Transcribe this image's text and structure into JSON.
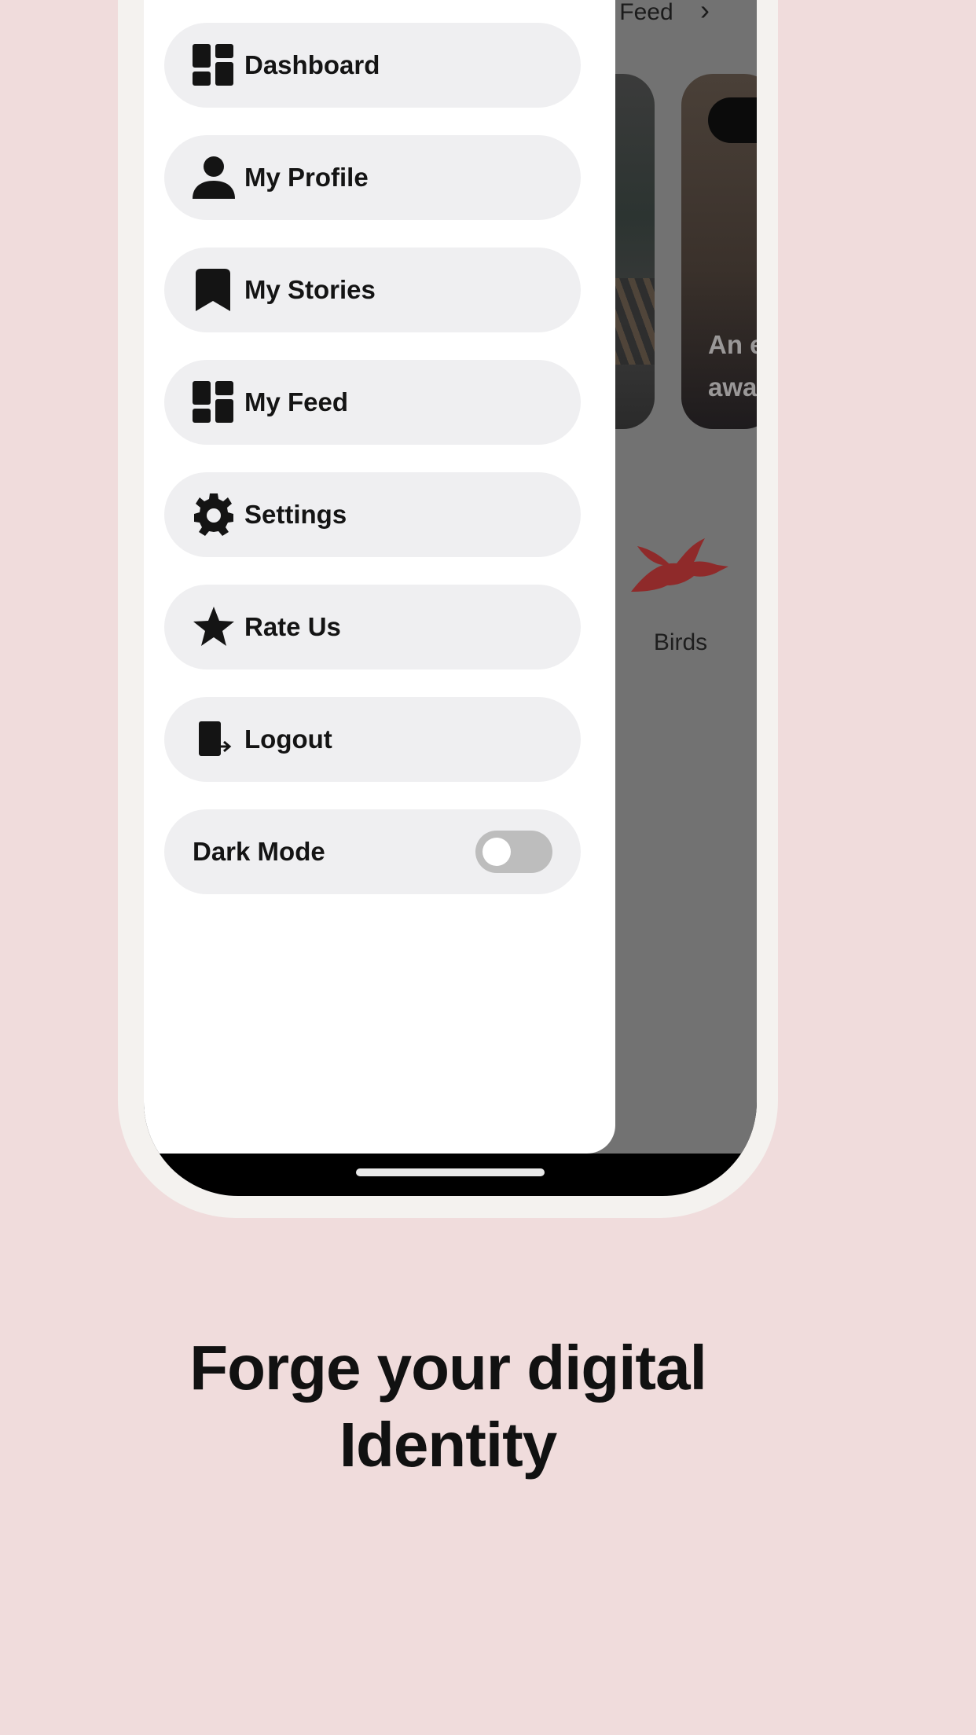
{
  "feed": {
    "see_more_label": "Feed",
    "cards": [
      {
        "caption_line1": "",
        "caption_line2": ""
      },
      {
        "caption_line1": "An e",
        "caption_line2": "awa"
      }
    ],
    "category": {
      "label": "Birds",
      "icon": "bird-icon",
      "icon_color": "#8f2a2a"
    }
  },
  "drawer": {
    "items": [
      {
        "label": "Dashboard",
        "icon": "dashboard-icon"
      },
      {
        "label": "My Profile",
        "icon": "person-icon"
      },
      {
        "label": "My Stories",
        "icon": "bookmark-icon"
      },
      {
        "label": "My Feed",
        "icon": "dashboard-icon"
      },
      {
        "label": "Settings",
        "icon": "gear-icon"
      },
      {
        "label": "Rate Us",
        "icon": "star-icon"
      },
      {
        "label": "Logout",
        "icon": "logout-icon"
      }
    ],
    "dark_mode": {
      "label": "Dark Mode",
      "enabled": false
    }
  },
  "headline": {
    "line1": "Forge your digital",
    "line2": "Identity"
  },
  "colors": {
    "page_background": "#f0dcdc",
    "drawer_item_background": "#efeff1",
    "scrim": "#727272"
  }
}
